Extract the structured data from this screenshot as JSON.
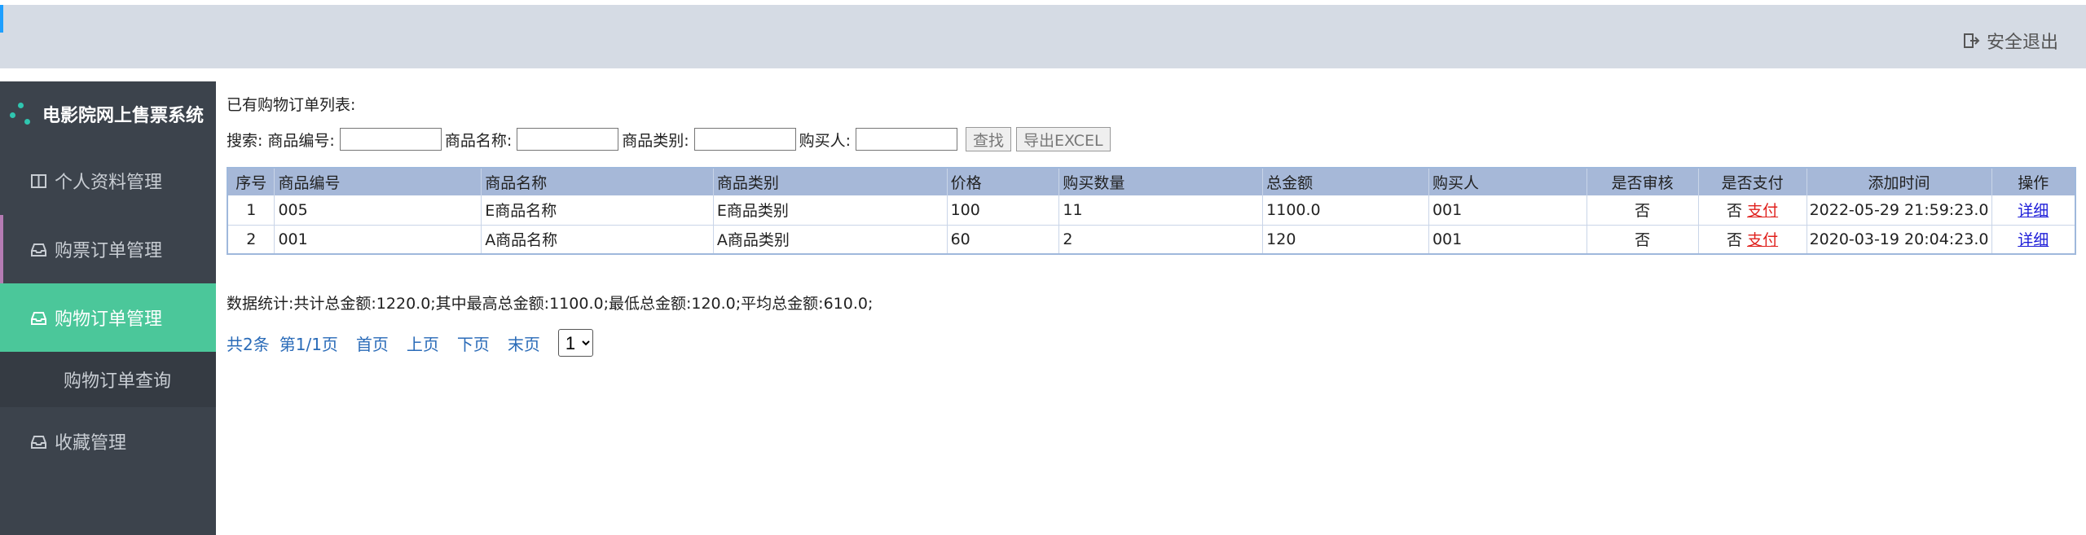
{
  "header": {
    "logout_label": "安全退出"
  },
  "sidebar": {
    "brand": "电影院网上售票系统",
    "items": [
      {
        "label": "个人资料管理"
      },
      {
        "label": "购票订单管理"
      },
      {
        "label": "购物订单管理"
      },
      {
        "label": "购物订单查询"
      },
      {
        "label": "收藏管理"
      }
    ]
  },
  "main": {
    "list_title": "已有购物订单列表:",
    "search": {
      "prefix": "搜索:",
      "code_label": "商品编号:",
      "name_label": "商品名称:",
      "category_label": "商品类别:",
      "buyer_label": "购买人:",
      "find_button": "查找",
      "export_button": "导出EXCEL"
    },
    "table": {
      "headers": [
        "序号",
        "商品编号",
        "商品名称",
        "商品类别",
        "价格",
        "购买数量",
        "总金额",
        "购买人",
        "是否审核",
        "是否支付",
        "添加时间",
        "操作"
      ],
      "rows": [
        {
          "no": "1",
          "code": "005",
          "name": "E商品名称",
          "category": "E商品类别",
          "price": "100",
          "qty": "11",
          "total": "1100.0",
          "buyer": "001",
          "audited": "否",
          "paid": "否",
          "pay_link": "支付",
          "time": "2022-05-29 21:59:23.0",
          "action": "详细"
        },
        {
          "no": "2",
          "code": "001",
          "name": "A商品名称",
          "category": "A商品类别",
          "price": "60",
          "qty": "2",
          "total": "120",
          "buyer": "001",
          "audited": "否",
          "paid": "否",
          "pay_link": "支付",
          "time": "2020-03-19 20:04:23.0",
          "action": "详细"
        }
      ]
    },
    "stats": "数据统计:共计总金额:1220.0;其中最高总金额:1100.0;最低总金额:120.0;平均总金额:610.0;",
    "pager": {
      "total": "共2条",
      "page": "第1/1页",
      "first": "首页",
      "prev": "上页",
      "next": "下页",
      "last": "末页",
      "select_value": "1"
    }
  }
}
